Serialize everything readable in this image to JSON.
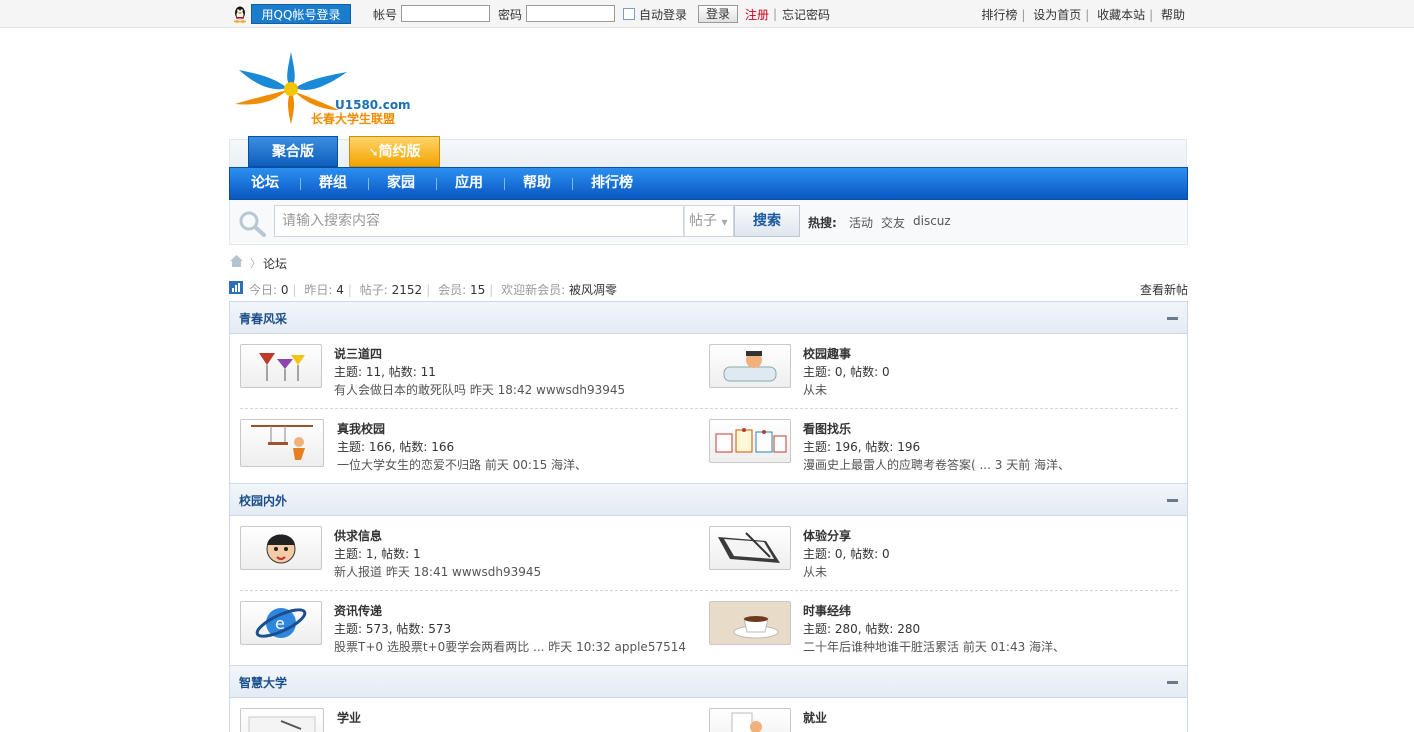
{
  "topbar": {
    "qq_login": "用QQ帐号登录",
    "account_label": "帐号",
    "password_label": "密码",
    "auto_login": "自动登录",
    "login_button": "登录",
    "register": "注册",
    "forgot": "忘记密码",
    "links": [
      "排行榜",
      "设为首页",
      "收藏本站",
      "帮助"
    ]
  },
  "logo": {
    "url_text": "U1580.com",
    "name": "长春大学生联盟"
  },
  "tabs": [
    "聚合版",
    "简约版"
  ],
  "nav": [
    "论坛",
    "群组",
    "家园",
    "应用",
    "帮助",
    "排行榜"
  ],
  "search": {
    "placeholder": "请输入搜索内容",
    "type": "帖子",
    "button": "搜索",
    "hot_label": "热搜:",
    "hot_words": [
      "活动",
      "交友",
      "discuz"
    ]
  },
  "breadcrumb": {
    "current": "论坛"
  },
  "stats": {
    "today_label": "今日:",
    "today": "0",
    "yesterday_label": "昨日:",
    "yesterday": "4",
    "posts_label": "帖子:",
    "posts": "2152",
    "members_label": "会员:",
    "members": "15",
    "welcome_label": "欢迎新会员:",
    "welcome_member": "被风凋零",
    "new_posts": "查看新帖"
  },
  "categories": [
    {
      "title": "青春风采",
      "forums": [
        {
          "name": "说三道四",
          "counts": "主题: 11, 帖数: 11",
          "last": "有人会做日本的敢死队吗 昨天 18:42 wwwsdh93945",
          "icon": "cocktail-glasses-icon"
        },
        {
          "name": "校园趣事",
          "counts": "主题: 0, 帖数: 0",
          "last": "从未",
          "icon": "bathtub-cartoon-icon"
        },
        {
          "name": "真我校园",
          "counts": "主题: 166, 帖数: 166",
          "last": "一位大学女生的恋爱不归路 前天 00:15 海洋、",
          "icon": "swing-girl-icon"
        },
        {
          "name": "看图找乐",
          "counts": "主题: 196, 帖数: 196",
          "last": "漫画史上最雷人的应聘考卷答案( ... 3 天前 海洋、",
          "icon": "pinned-notes-icon"
        }
      ]
    },
    {
      "title": "校园内外",
      "forums": [
        {
          "name": "供求信息",
          "counts": "主题: 1, 帖数: 1",
          "last": "新人报道 昨天 18:41 wwwsdh93945",
          "icon": "cartoon-face-icon"
        },
        {
          "name": "体验分享",
          "counts": "主题: 0, 帖数: 0",
          "last": "从未",
          "icon": "notebook-pen-icon"
        },
        {
          "name": "资讯传递",
          "counts": "主题: 573, 帖数: 573",
          "last": "股票T+0 选股票t+0要学会两看两比 ... 昨天 10:32 apple57514",
          "icon": "internet-globe-icon"
        },
        {
          "name": "时事经纬",
          "counts": "主题: 280, 帖数: 280",
          "last": "二十年后谁种地谁干脏活累活 前天 01:43 海洋、",
          "icon": "coffee-cup-icon"
        }
      ]
    },
    {
      "title": "智慧大学",
      "forums": [
        {
          "name": "学业",
          "counts": "",
          "last": "",
          "icon": "study-desk-icon"
        },
        {
          "name": "就业",
          "counts": "",
          "last": "",
          "icon": "job-person-icon"
        }
      ]
    }
  ]
}
